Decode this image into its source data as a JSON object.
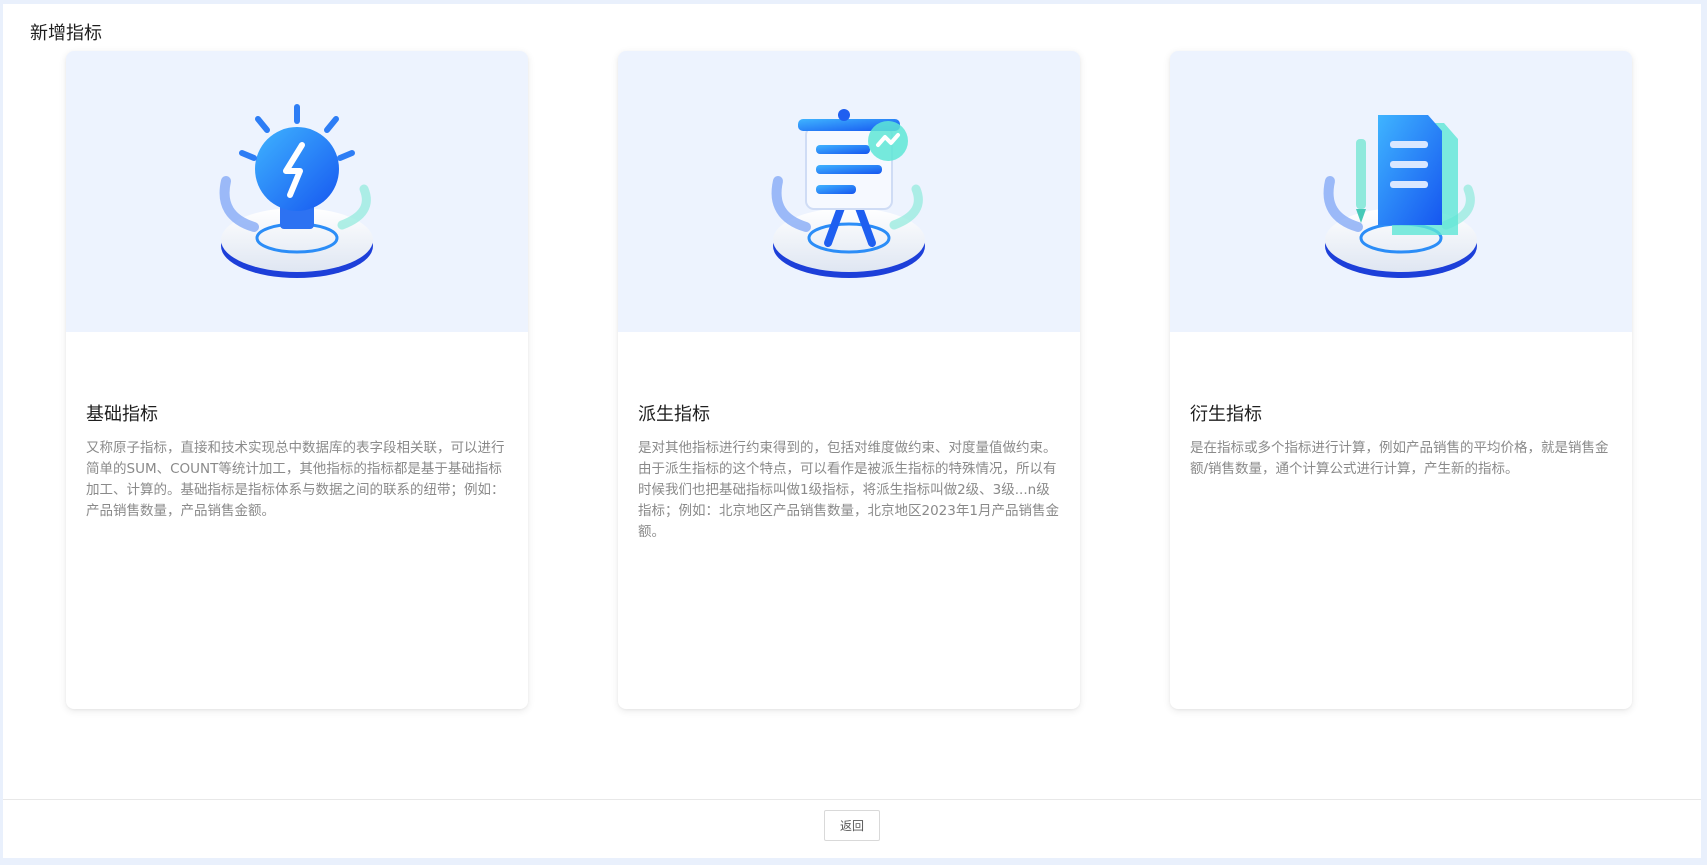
{
  "page": {
    "title": "新增指标"
  },
  "cards": [
    {
      "title": "基础指标",
      "description": "又称原子指标，直接和技术实现总中数据库的表字段相关联，可以进行简单的SUM、COUNT等统计加工，其他指标的指标都是基于基础指标加工、计算的。基础指标是指标体系与数据之间的联系的纽带；例如：产品销售数量，产品销售金额。",
      "icon": "lightbulb-illustration-icon"
    },
    {
      "title": "派生指标",
      "description": "是对其他指标进行约束得到的，包括对维度做约束、对度量值做约束。由于派生指标的这个特点，可以看作是被派生指标的特殊情况，所以有时候我们也把基础指标叫做1级指标，将派生指标叫做2级、3级...n级指标；例如：北京地区产品销售数量，北京地区2023年1月产品销售金额。",
      "icon": "easel-chart-illustration-icon"
    },
    {
      "title": "衍生指标",
      "description": "是在指标或多个指标进行计算，例如产品销售的平均价格，就是销售金额/销售数量，通个计算公式进行计算，产生新的指标。",
      "icon": "document-pencil-illustration-icon"
    }
  ],
  "footer": {
    "back_label": "返回"
  },
  "colors": {
    "page_background": "#e9f0fc",
    "card_media_background": "#edf3fe",
    "accent_blue": "#1e6ff5",
    "accent_cyan": "#5ee6d6"
  }
}
